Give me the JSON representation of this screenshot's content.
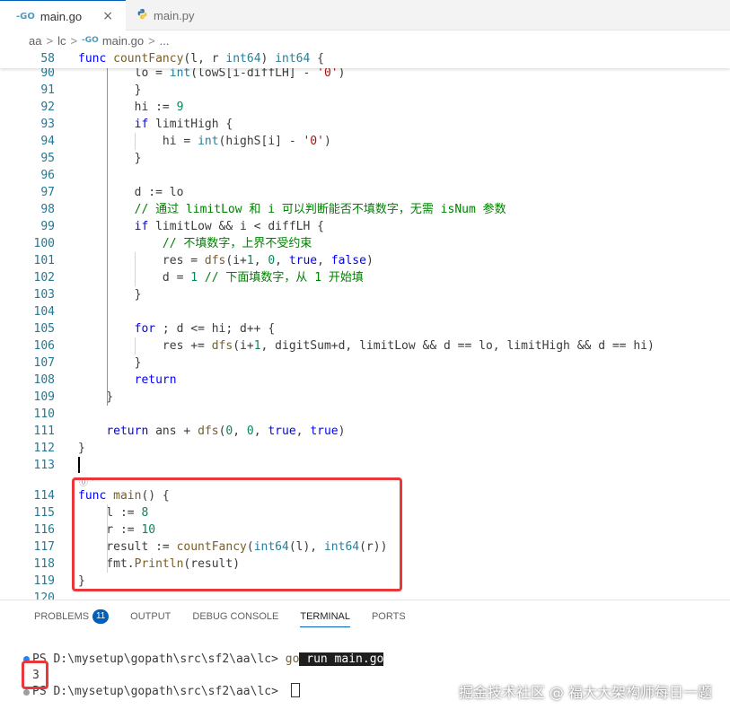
{
  "tabs": [
    {
      "icon": "go-file-icon",
      "glyph": "-GO",
      "label": "main.go",
      "active": true,
      "close": "×"
    },
    {
      "icon": "python-file-icon",
      "glyph": "🐍",
      "label": "main.py",
      "active": false
    }
  ],
  "breadcrumb": {
    "folder1": "aa",
    "folder2": "lc",
    "file": "main.go",
    "rest": "...",
    "sep": ">",
    "file_glyph": "-GO"
  },
  "editor": {
    "sticky": {
      "number": "58",
      "code": "func countFancy(l, r int64) int64 {"
    },
    "codelens": "⓪ ˅",
    "lines": [
      {
        "number": "90",
        "code": "        lo = int(lowS[i-diffLH] - '0')"
      },
      {
        "number": "91",
        "code": "        }"
      },
      {
        "number": "92",
        "code": "        hi := 9"
      },
      {
        "number": "93",
        "code": "        if limitHigh {"
      },
      {
        "number": "94",
        "code": "            hi = int(highS[i] - '0')"
      },
      {
        "number": "95",
        "code": "        }"
      },
      {
        "number": "96",
        "code": ""
      },
      {
        "number": "97",
        "code": "        d := lo"
      },
      {
        "number": "98",
        "code": "        // 通过 limitLow 和 i 可以判断能否不填数字，无需 isNum 参数"
      },
      {
        "number": "99",
        "code": "        if limitLow && i < diffLH {"
      },
      {
        "number": "100",
        "code": "            // 不填数字，上界不受约束"
      },
      {
        "number": "101",
        "code": "            res = dfs(i+1, 0, true, false)"
      },
      {
        "number": "102",
        "code": "            d = 1 // 下面填数字，从 1 开始填"
      },
      {
        "number": "103",
        "code": "        }"
      },
      {
        "number": "104",
        "code": ""
      },
      {
        "number": "105",
        "code": "        for ; d <= hi; d++ {"
      },
      {
        "number": "106",
        "code": "            res += dfs(i+1, digitSum+d, limitLow && d == lo, limitHigh && d == hi)"
      },
      {
        "number": "107",
        "code": "        }"
      },
      {
        "number": "108",
        "code": "        return"
      },
      {
        "number": "109",
        "code": "    }"
      },
      {
        "number": "110",
        "code": ""
      },
      {
        "number": "111",
        "code": "    return ans + dfs(0, 0, true, true)"
      },
      {
        "number": "112",
        "code": "}"
      },
      {
        "number": "113",
        "code": ""
      },
      {
        "number": "114",
        "code": "func main() {"
      },
      {
        "number": "115",
        "code": "    l := 8"
      },
      {
        "number": "116",
        "code": "    r := 10"
      },
      {
        "number": "117",
        "code": "    result := countFancy(int64(l), int64(r))"
      },
      {
        "number": "118",
        "code": "    fmt.Println(result)"
      },
      {
        "number": "119",
        "code": "}"
      },
      {
        "number": "120",
        "code": ""
      }
    ]
  },
  "panel": {
    "tabs": [
      {
        "label": "PROBLEMS",
        "badge": "11"
      },
      {
        "label": "OUTPUT"
      },
      {
        "label": "DEBUG CONSOLE"
      },
      {
        "label": "TERMINAL",
        "active": true
      },
      {
        "label": "PORTS"
      }
    ],
    "terminal": {
      "prompt1": "PS D:\\mysetup\\gopath\\src\\sf2\\aa\\lc> ",
      "cmd_go": "go",
      "cmd_rest": " run main.go",
      "output": "3",
      "prompt2": "PS D:\\mysetup\\gopath\\src\\sf2\\aa\\lc> "
    }
  },
  "watermark": "掘金技术社区 @ 福大大架构师每日一题",
  "colors": {
    "accent": "#005fb8",
    "highlight_box": "#e8383b",
    "keyword": "#0000ff",
    "type": "#267f99",
    "function": "#795e26",
    "number": "#098658",
    "string": "#a31515",
    "comment": "#008000"
  }
}
